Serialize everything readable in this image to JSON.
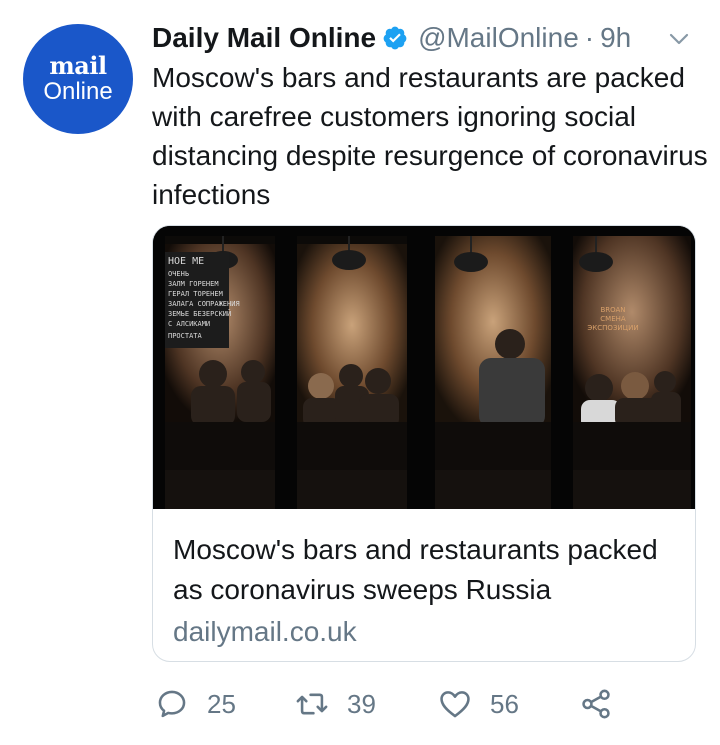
{
  "avatar": {
    "brand_top": "mail",
    "brand_bottom": "Online",
    "color": "#1a57c9"
  },
  "author": {
    "display_name": "Daily Mail Online",
    "verified": true,
    "handle": "@MailOnline",
    "separator": "·",
    "time": "9h"
  },
  "tweet": {
    "text": "Moscow's bars and restaurants are packed with carefree customers ignoring social distancing despite resurgence of coronavirus infections"
  },
  "card": {
    "image_alt": "Diners inside a Moscow restaurant",
    "title": "Moscow's bars and restaurants packed as coronavirus sweeps Russia",
    "domain": "dailymail.co.uk",
    "menu_board_lines": [
      "НОЕ МЕ",
      "ОЧЕНЬ",
      "ЗАЛМ ГОРЕНЕМ",
      "ГЕРАЛ ТОРЕНЕМ",
      "ЗАЛАГА СОПРАЖЕНИЯ",
      "ЗЕМЬЕ БЕЗЕРСКИЙ",
      "С АЛСИКАМИ",
      "ПРОСТАТА"
    ],
    "wall_sign_lines": [
      "BROAN",
      "СМЕНА",
      "ЭКСПОЗИЦИИ"
    ]
  },
  "actions": {
    "reply_count": "25",
    "retweet_count": "39",
    "like_count": "56"
  },
  "colors": {
    "text": "#14171a",
    "muted": "#657786",
    "verified": "#1da1f2",
    "border": "#d7dee4"
  }
}
